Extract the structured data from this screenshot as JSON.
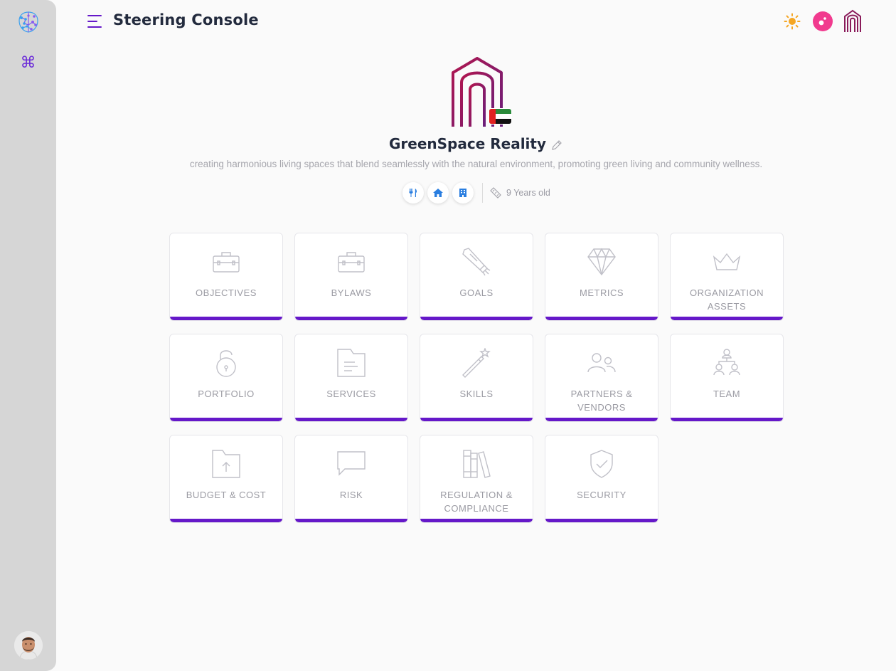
{
  "app": {
    "title": "Steering Console"
  },
  "sidebar": {
    "logo": "brain-logo-icon",
    "command_icon": "⌘",
    "avatar": "user-avatar"
  },
  "header": {
    "icons": [
      "sun-icon",
      "pink-drop-icon",
      "org-brand-icon"
    ]
  },
  "organization": {
    "name": "GreenSpace Reality",
    "description": "creating harmonious living spaces that blend seamlessly with the natural environment, promoting green living and community wellness.",
    "age": "9 Years old",
    "flag": "uae-flag",
    "industry_chips": [
      "restaurant-icon",
      "home-icon",
      "building-icon"
    ]
  },
  "colors": {
    "accent": "#6518c9",
    "brand": "#8a1b5a",
    "pink": "#f13a8e",
    "sun": "#f5a623"
  },
  "modules": [
    {
      "label": "OBJECTIVES",
      "icon": "briefcase-icon"
    },
    {
      "label": "BYLAWS",
      "icon": "briefcase-icon"
    },
    {
      "label": "GOALS",
      "icon": "rocket-icon"
    },
    {
      "label": "METRICS",
      "icon": "diamond-icon"
    },
    {
      "label": "ORGANIZATION ASSETS",
      "icon": "crown-icon"
    },
    {
      "label": "PORTFOLIO",
      "icon": "unlock-icon"
    },
    {
      "label": "SERVICES",
      "icon": "folder-doc-icon"
    },
    {
      "label": "SKILLS",
      "icon": "magic-wand-icon"
    },
    {
      "label": "PARTNERS & VENDORS",
      "icon": "users-icon"
    },
    {
      "label": "TEAM",
      "icon": "team-hierarchy-icon"
    },
    {
      "label": "BUDGET & COST",
      "icon": "folder-upload-icon"
    },
    {
      "label": "RISK",
      "icon": "chat-bubble-icon"
    },
    {
      "label": "REGULATION & COMPLIANCE",
      "icon": "books-icon"
    },
    {
      "label": "SECURITY",
      "icon": "shield-check-icon"
    }
  ]
}
